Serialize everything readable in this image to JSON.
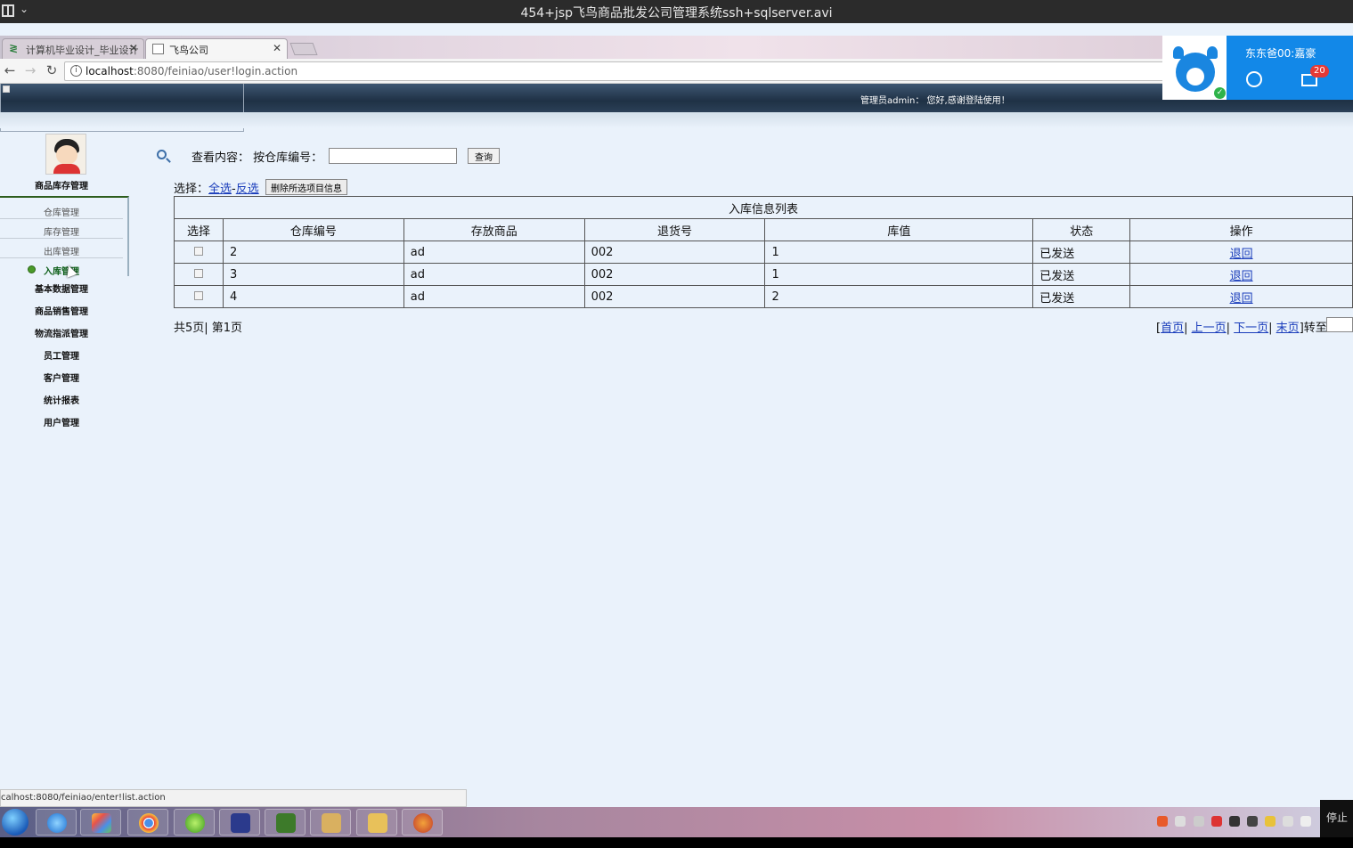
{
  "player": {
    "title": "454+jsp飞鸟商品批发公司管理系统ssh+sqlserver.avi"
  },
  "browser": {
    "tabs": [
      {
        "label": "计算机毕业设计_毕业设计"
      },
      {
        "label": "飞鸟公司"
      }
    ],
    "url": {
      "host": "localhost",
      "path": ":8080/feiniao/user!login.action"
    },
    "status_url": "calhost:8080/feiniao/enter!list.action"
  },
  "header": {
    "welcome": "管理员admin： 您好,感谢登陆使用！"
  },
  "sidebar": {
    "current_group": "商品库存管理",
    "subitems": [
      {
        "label": "仓库管理"
      },
      {
        "label": "库存管理"
      },
      {
        "label": "出库管理"
      },
      {
        "label": "入库管理"
      }
    ],
    "groups": [
      {
        "label": "基本数据管理"
      },
      {
        "label": "商品销售管理"
      },
      {
        "label": "物流指派管理"
      },
      {
        "label": "员工管理"
      },
      {
        "label": "客户管理"
      },
      {
        "label": "统计报表"
      },
      {
        "label": "用户管理"
      }
    ]
  },
  "search": {
    "label": "查看内容： 按仓库编号：",
    "value": "",
    "button": "查询"
  },
  "selection": {
    "prefix": "选择：",
    "select_all": "全选",
    "separator": "-",
    "invert": "反选",
    "delete_button": "删除所选项目信息"
  },
  "table": {
    "caption": "入库信息列表",
    "headers": [
      "选择",
      "仓库编号",
      "存放商品",
      "退货号",
      "库值",
      "状态",
      "操作"
    ],
    "rows": [
      {
        "warehouse_no": "2",
        "product": "ad",
        "return_no": "002",
        "stock": "1",
        "status": "已发送",
        "action": "退回"
      },
      {
        "warehouse_no": "3",
        "product": "ad",
        "return_no": "002",
        "stock": "1",
        "status": "已发送",
        "action": "退回"
      },
      {
        "warehouse_no": "4",
        "product": "ad",
        "return_no": "002",
        "stock": "2",
        "status": "已发送",
        "action": "退回"
      }
    ]
  },
  "pager": {
    "summary": "共5页| 第1页",
    "first": "首页",
    "prev": "上一页",
    "next": "下一页",
    "last": "末页",
    "goto": "转至"
  },
  "overlay": {
    "user": "东东爸00:嘉豪",
    "badge": "20"
  },
  "taskbar": {
    "stop_text": "停止"
  },
  "colors": {
    "link": "#1a3dbb",
    "header_bg": "#1f3145",
    "page_bg": "#eaf2fb",
    "widget_blue": "#1288e8"
  }
}
